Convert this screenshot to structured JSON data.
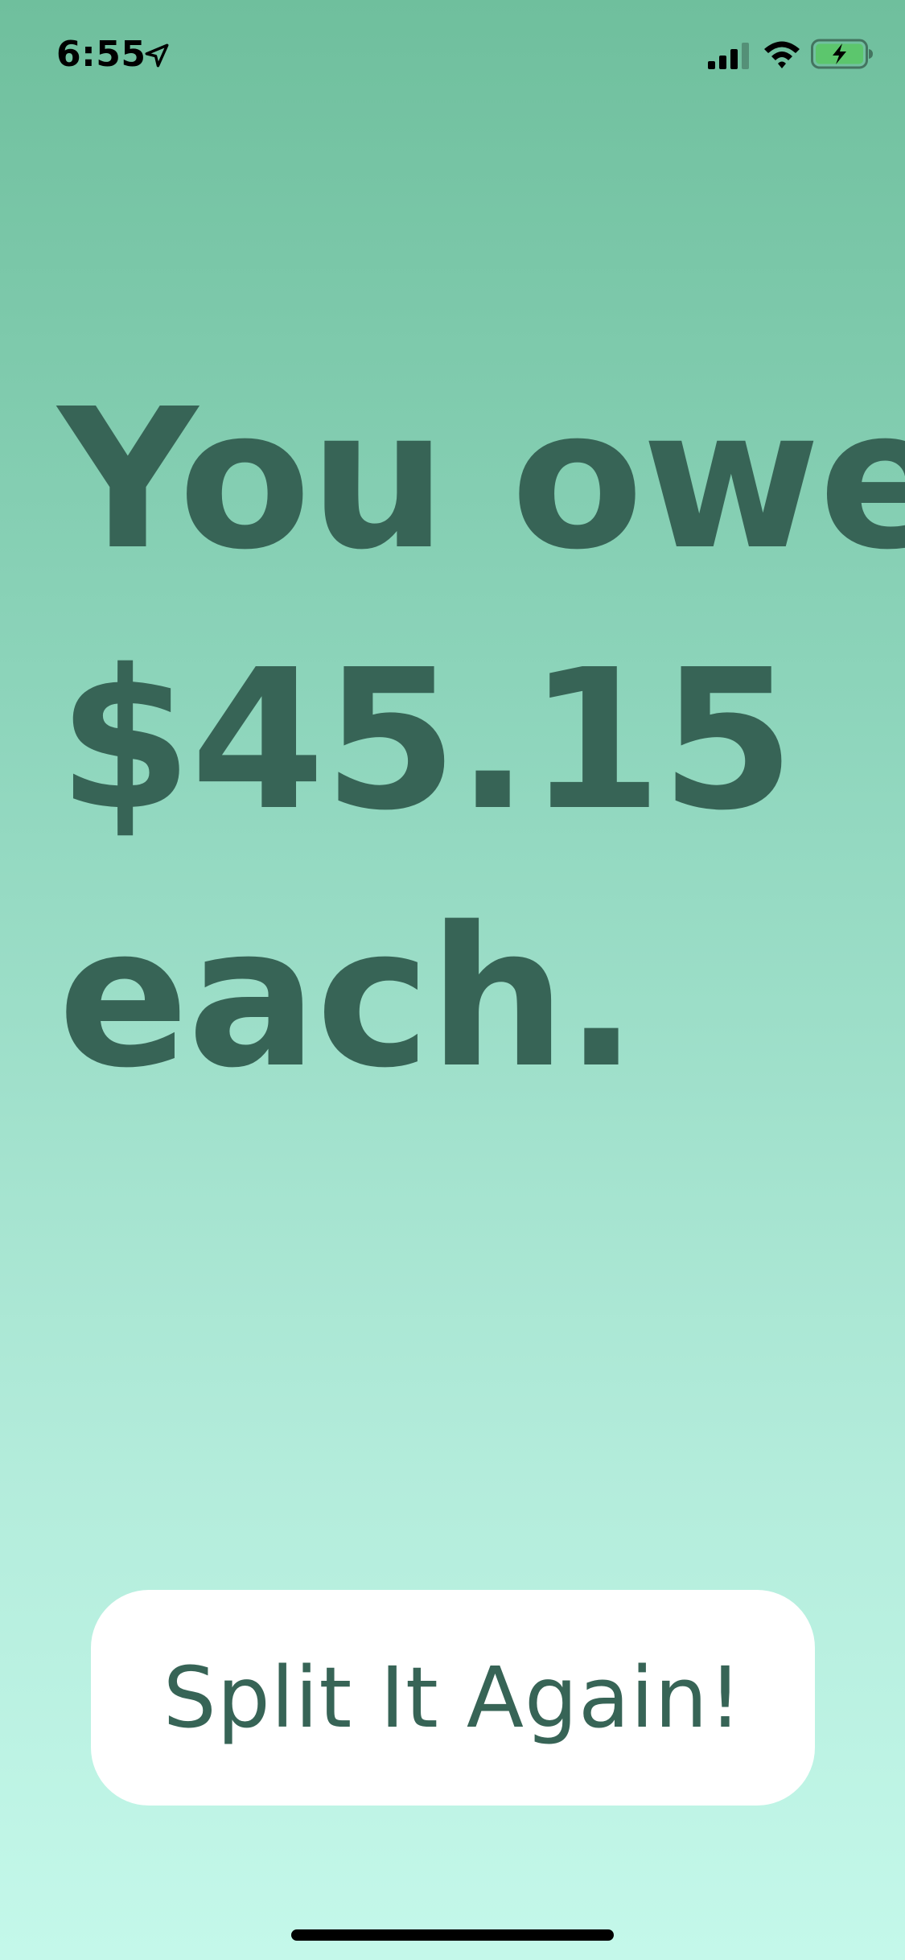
{
  "status_bar": {
    "time": "6:55",
    "location_icon": "location-arrow-icon",
    "signal_icon": "cellular-signal-icon",
    "wifi_icon": "wifi-icon",
    "battery_icon": "battery-charging-icon",
    "battery_color": "#5cc66d"
  },
  "result": {
    "line1": "You owe",
    "line2": "$45.15",
    "line3": "each."
  },
  "actions": {
    "split_again_label": "Split It Again!"
  },
  "colors": {
    "text": "#376456",
    "background_top": "#6fbf9d",
    "background_bottom": "#c4f8ea",
    "button_bg": "#ffffff"
  }
}
